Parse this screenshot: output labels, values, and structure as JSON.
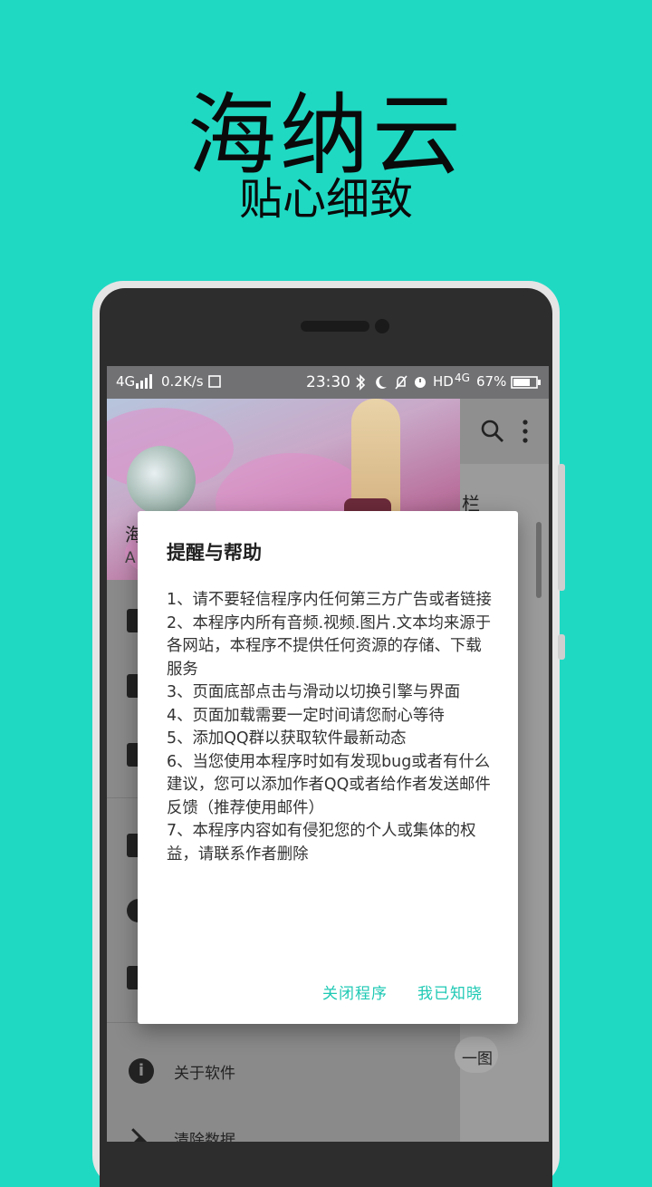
{
  "promo": {
    "title": "海纳云",
    "subtitle": "贴心细致"
  },
  "status_bar": {
    "network": "4G",
    "speed": "0.2K/s",
    "time": "23:30",
    "hd": "HD",
    "network2": "4G",
    "battery": "67%"
  },
  "drawer": {
    "header_initial": "海",
    "header_sub": "A",
    "items": [
      {
        "label": "关于软件",
        "icon": "info-icon"
      },
      {
        "label": "清除数据",
        "icon": "clear-data-icon"
      }
    ]
  },
  "background_fragments": {
    "tab_fragment": "栏",
    "button_fragment": "一图"
  },
  "dialog": {
    "title": "提醒与帮助",
    "body": "1、请不要轻信程序内任何第三方广告或者链接\n2、本程序内所有音频.视频.图片.文本均来源于各网站，本程序不提供任何资源的存储、下载服务\n3、页面底部点击与滑动以切换引擎与界面\n4、页面加载需要一定时间请您耐心等待\n5、添加QQ群以获取软件最新动态\n6、当您使用本程序时如有发现bug或者有什么建议，您可以添加作者QQ或者给作者发送邮件反馈（推荐使用邮件）\n7、本程序内容如有侵犯您的个人或集体的权益，请联系作者删除",
    "close_button": "关闭程序",
    "ok_button": "我已知晓"
  },
  "colors": {
    "background": "#1fd9c3",
    "accent": "#1fc9b4"
  }
}
